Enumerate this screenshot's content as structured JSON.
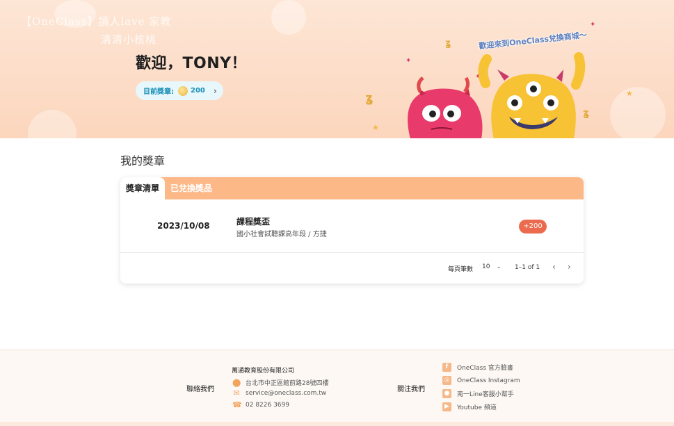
{
  "hero": {
    "watermark_line1": "【OneClass】讀人lave 家教",
    "watermark_line2": "清清小核桃",
    "welcome": "歡迎，TONY！",
    "badge_label": "目前獎章:",
    "badge_count": "200",
    "banner_text": "歡迎來到OneClass兌換商城～"
  },
  "section": {
    "title": "我的獎章",
    "tabs": [
      {
        "label": "獎章清單",
        "active": true
      },
      {
        "label": "已兌換獎品",
        "active": false
      }
    ],
    "rows": [
      {
        "date": "2023/10/08",
        "title": "課程獎盃",
        "subtitle": "國小社會試聽課高年段 / 方捷",
        "points": "+200"
      }
    ],
    "pagination": {
      "per_page_label": "每頁筆數",
      "per_page_value": "10",
      "range": "1–1 of 1"
    }
  },
  "footer": {
    "contact_title": "聯絡我們",
    "company": "萬通教育股份有限公司",
    "address": "台北市中正區館前路28號四樓",
    "email": "service@oneclass.com.tw",
    "phone": "02 8226 3699",
    "follow_title": "關注我們",
    "social": [
      {
        "label": "OneClass 官方臉書",
        "icon": "facebook-icon"
      },
      {
        "label": "OneClass Instagram",
        "icon": "instagram-icon"
      },
      {
        "label": "南一Line客服小幫手",
        "icon": "line-icon"
      },
      {
        "label": "Youtube 頻道",
        "icon": "youtube-icon"
      }
    ]
  },
  "colors": {
    "accent": "#fdb887",
    "points_badge": "#ec6b4e",
    "badge_text": "#1a8fb7",
    "footer_icon": "#f2a35e"
  }
}
